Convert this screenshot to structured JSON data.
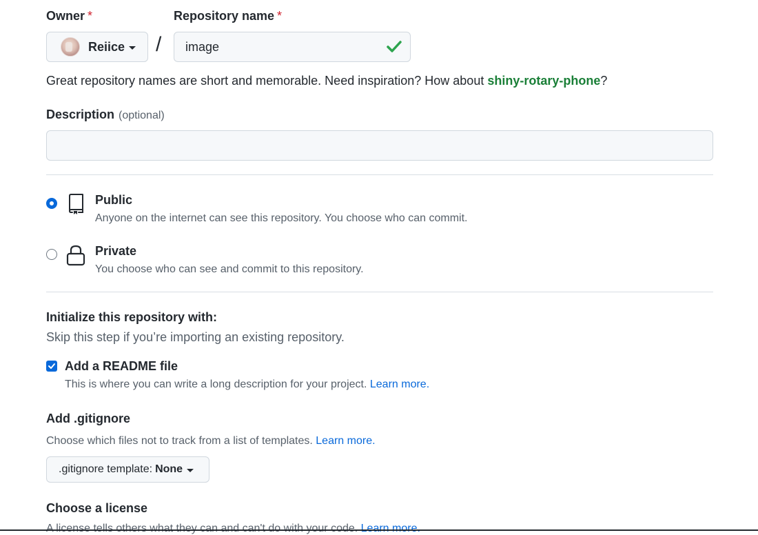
{
  "owner": {
    "label": "Owner",
    "required_mark": "*",
    "name": "Reiice"
  },
  "repo": {
    "label": "Repository name",
    "required_mark": "*",
    "value": "image",
    "separator": "/"
  },
  "hint": {
    "prefix": "Great repository names are short and memorable. Need inspiration? How about ",
    "suggestion": "shiny-rotary-phone",
    "suffix": "?"
  },
  "description": {
    "label": "Description",
    "optional": "(optional)",
    "value": ""
  },
  "visibility": {
    "public": {
      "title": "Public",
      "desc": "Anyone on the internet can see this repository. You choose who can commit.",
      "selected": true
    },
    "private": {
      "title": "Private",
      "desc": "You choose who can see and commit to this repository.",
      "selected": false
    }
  },
  "init": {
    "title": "Initialize this repository with:",
    "subtitle": "Skip this step if you’re importing an existing repository.",
    "readme_label": "Add a README file",
    "readme_desc": "This is where you can write a long description for your project. ",
    "readme_link": "Learn more."
  },
  "gitignore": {
    "title": "Add .gitignore",
    "desc": "Choose which files not to track from a list of templates. ",
    "link": "Learn more.",
    "button_prefix": ".gitignore template:",
    "button_value": "None"
  },
  "license": {
    "title": "Choose a license",
    "desc": "A license tells others what they can and can't do with your code. ",
    "link": "Learn more."
  },
  "colors": {
    "accent": "#0969da",
    "success": "#1a7f37",
    "check": "#2da44e",
    "danger": "#cf222e"
  }
}
